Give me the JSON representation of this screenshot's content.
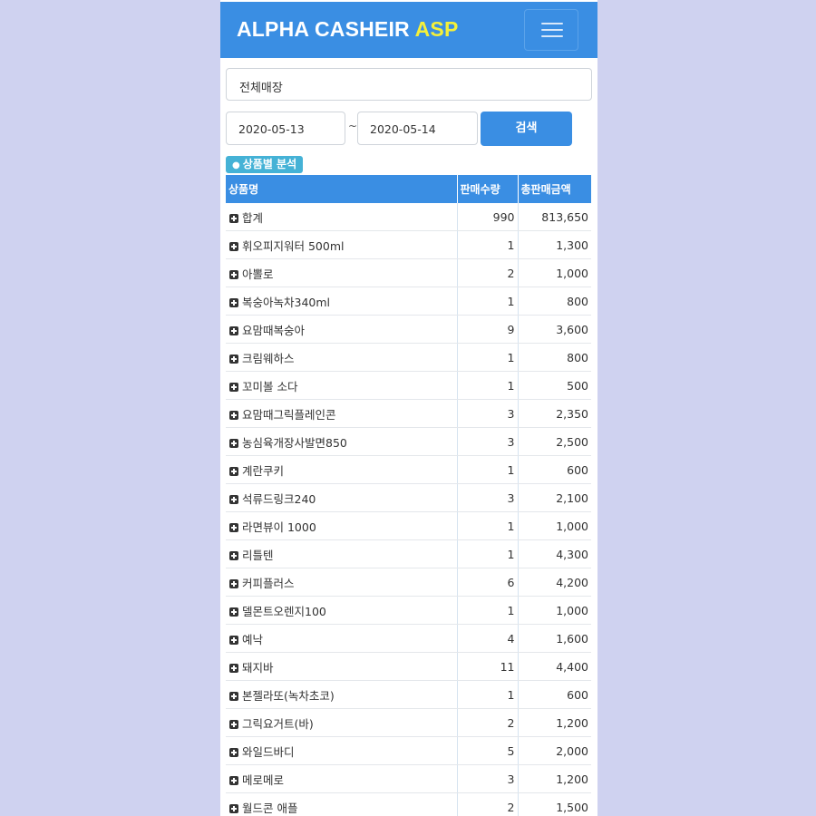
{
  "header": {
    "brand_main": "ALPHA CASHEIR",
    "brand_accent": "ASP"
  },
  "filters": {
    "store": "전체매장",
    "date_from": "2020-05-13",
    "separator": "~",
    "date_to": "2020-05-14",
    "search_label": "검색"
  },
  "section": {
    "bullet": "●",
    "label": "상품별 분석"
  },
  "table": {
    "headers": [
      "상품명",
      "판매수량",
      "총판매금액"
    ],
    "rows": [
      {
        "name": "합계",
        "qty": "990",
        "amount": "813,650"
      },
      {
        "name": "휘오피지워터 500ml",
        "qty": "1",
        "amount": "1,300"
      },
      {
        "name": "아뽈로",
        "qty": "2",
        "amount": "1,000"
      },
      {
        "name": "복숭아녹차340ml",
        "qty": "1",
        "amount": "800"
      },
      {
        "name": "요맘때복숭아",
        "qty": "9",
        "amount": "3,600"
      },
      {
        "name": "크림웨하스",
        "qty": "1",
        "amount": "800"
      },
      {
        "name": "꼬미볼 소다",
        "qty": "1",
        "amount": "500"
      },
      {
        "name": "요맘때그릭플레인콘",
        "qty": "3",
        "amount": "2,350"
      },
      {
        "name": "농심육개장사발면850",
        "qty": "3",
        "amount": "2,500"
      },
      {
        "name": "계란쿠키",
        "qty": "1",
        "amount": "600"
      },
      {
        "name": "석류드링크240",
        "qty": "3",
        "amount": "2,100"
      },
      {
        "name": "라면뷰이 1000",
        "qty": "1",
        "amount": "1,000"
      },
      {
        "name": "리틀텐",
        "qty": "1",
        "amount": "4,300"
      },
      {
        "name": "커피플러스",
        "qty": "6",
        "amount": "4,200"
      },
      {
        "name": "델몬트오렌지100",
        "qty": "1",
        "amount": "1,000"
      },
      {
        "name": "예낙",
        "qty": "4",
        "amount": "1,600"
      },
      {
        "name": "돼지바",
        "qty": "11",
        "amount": "4,400"
      },
      {
        "name": "본젤라또(녹차초코)",
        "qty": "1",
        "amount": "600"
      },
      {
        "name": "그릭요거트(바)",
        "qty": "2",
        "amount": "1,200"
      },
      {
        "name": "와일드바디",
        "qty": "5",
        "amount": "2,000"
      },
      {
        "name": "메로메로",
        "qty": "3",
        "amount": "1,200"
      },
      {
        "name": "월드콘 애플",
        "qty": "2",
        "amount": "1,500"
      }
    ]
  },
  "icons": {
    "menu": "hamburger-menu-icon",
    "expand": "plus-square-icon"
  },
  "colors": {
    "primary": "#3a8ee3",
    "brand_accent": "#f4f03a",
    "section_badge": "#45b2d6",
    "page_background": "#cfd2f0"
  }
}
